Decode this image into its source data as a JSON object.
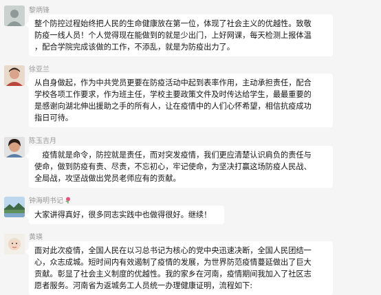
{
  "messages": [
    {
      "name": "黎炳锋",
      "lines": [
        "整个防控过程始终把人民的生命健康放在第一位，体现了社会主义的优越性。致敬",
        "防疫一线人员！个人觉得现在能做到的就是少出门，上好网课，每天检测上报体温",
        "，配合学院完成该做的工作，不添乱，就是为防疫出力了。"
      ]
    },
    {
      "name": "徐亚兰",
      "lines": [
        "从自身做起，作为中共党员更要在防疫活动中起到表率作用，主动承担责任，配合",
        "学校各项工作要求，作为班主任，学校主要政策文件及时传达给学生，最最重要的",
        "是感谢向湖北伸出援助之手的所有人，让在疫情中的人们心怀希望，相信抗疫成功",
        "指日可待。"
      ]
    },
    {
      "name": "陈玉吉月",
      "lines": [
        "　疫情就是命令，防控就是责任，而对突发疫情，我们更应清楚认识肩负的责任与",
        "使命，做到防疫有责、尽责，不忘初心，牢记使命，为坚决打赢这场防疫人民战、",
        "全局战，攻坚战做出党员老师应有的贡献。"
      ]
    },
    {
      "name": "钟海明书记",
      "lines": [
        "大家讲得真好，很多同志实践中也做得很好。继续！"
      ]
    },
    {
      "name": "黄瑛",
      "lines": [
        "面对此次疫情，全国人民在以习总书记为核心的党中央迅速决断，全国人民团结一",
        "心，众志成城。短时间内有效遏制了疫情的发展，为世界防范疫情蔓延做出了巨大",
        "贡献。彰显了社会主义制度的优越性。我的家乡在河南，疫情期间我加入了社区志",
        "愿者服务。河南省为返城务工人员统一办理健康证明，流程如下:"
      ]
    }
  ]
}
